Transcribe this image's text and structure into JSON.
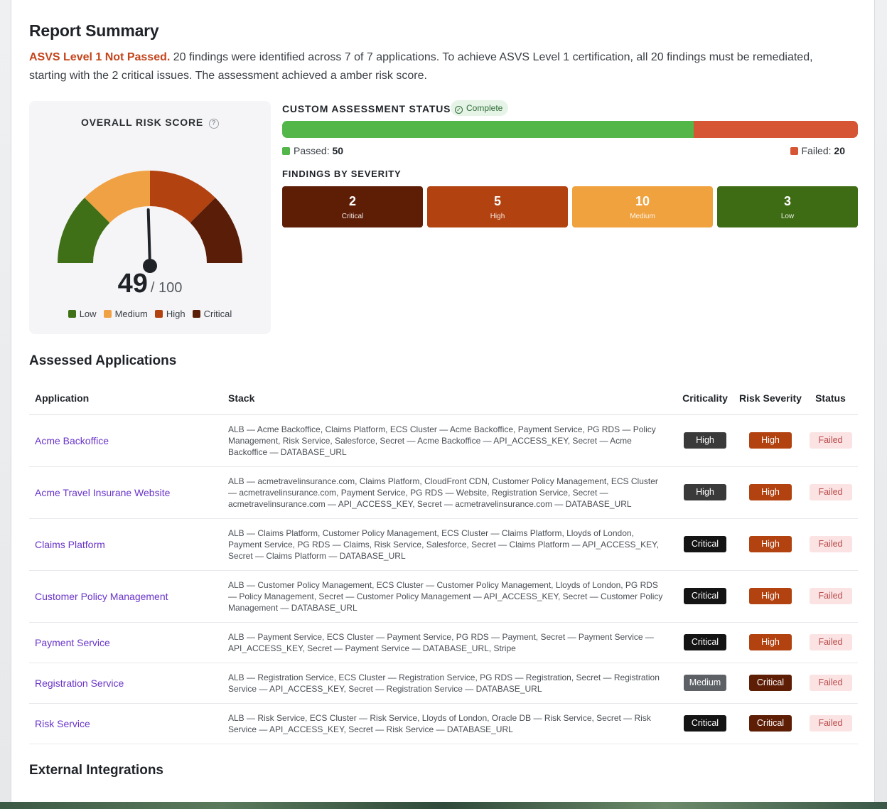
{
  "report": {
    "title": "Report Summary",
    "summary_status": "ASVS Level 1 Not Passed.",
    "summary_text": " 20 findings were identified across 7 of 7 applications. To achieve ASVS Level 1 certification, all 20 findings must be remediated, starting with the 2 critical issues. The assessment achieved a amber risk score."
  },
  "risk_score": {
    "title": "OVERALL RISK SCORE",
    "help_icon": "?",
    "value": "49",
    "max": "/ 100",
    "score_numeric": 49,
    "colors": {
      "low": "#3f6f16",
      "medium": "#f0a144",
      "high": "#b2420f",
      "critical": "#5a1d07"
    },
    "legend": [
      {
        "label": "Low",
        "color": "#3f6f16"
      },
      {
        "label": "Medium",
        "color": "#f0a144"
      },
      {
        "label": "High",
        "color": "#b2420f"
      },
      {
        "label": "Critical",
        "color": "#5a1d07"
      }
    ]
  },
  "custom_assessment": {
    "title": "CUSTOM ASSESSMENT STATUS",
    "badge": "Complete",
    "badge_icon": "check-circle-icon",
    "passed_label": "Passed: ",
    "passed_value": "50",
    "passed": 50,
    "failed_label": "Failed: ",
    "failed_value": "20",
    "failed": 20,
    "pass_color": "#52b649",
    "fail_color": "#d55535"
  },
  "findings_by_severity": {
    "title": "FINDINGS BY SEVERITY",
    "items": [
      {
        "count": "2",
        "label": "Critical",
        "color": "#5e1e06"
      },
      {
        "count": "5",
        "label": "High",
        "color": "#b2420f"
      },
      {
        "count": "10",
        "label": "Medium",
        "color": "#f0a23e"
      },
      {
        "count": "3",
        "label": "Low",
        "color": "#3e6c14"
      }
    ]
  },
  "applications": {
    "title": "Assessed Applications",
    "columns": [
      "Application",
      "Stack",
      "Criticality",
      "Risk Severity",
      "Status"
    ],
    "pill_colors": {
      "High": "#3a3a3a",
      "Critical": "#141414",
      "Medium": "#5d6166",
      "risk_High": "#b2420f",
      "risk_Critical": "#5e1e06"
    },
    "rows": [
      {
        "name": "Acme Backoffice",
        "stack": "ALB — Acme Backoffice, Claims Platform, ECS Cluster — Acme Backoffice, Payment Service, PG RDS — Policy Management, Risk Service, Salesforce, Secret — Acme Backoffice — API_ACCESS_KEY, Secret — Acme Backoffice — DATABASE_URL",
        "criticality": "High",
        "risk": "High",
        "status": "Failed"
      },
      {
        "name": "Acme Travel Insurane Website",
        "stack": "ALB — acmetravelinsurance.com, Claims Platform, CloudFront CDN, Customer Policy Management, ECS Cluster — acmetravelinsurance.com, Payment Service, PG RDS — Website, Registration Service, Secret — acmetravelinsurance.com — API_ACCESS_KEY, Secret — acmetravelinsurance.com — DATABASE_URL",
        "criticality": "High",
        "risk": "High",
        "status": "Failed"
      },
      {
        "name": "Claims Platform",
        "stack": "ALB — Claims Platform, Customer Policy Management, ECS Cluster — Claims Platform, Lloyds of London, Payment Service, PG RDS — Claims, Risk Service, Salesforce, Secret — Claims Platform — API_ACCESS_KEY, Secret — Claims Platform — DATABASE_URL",
        "criticality": "Critical",
        "risk": "High",
        "status": "Failed"
      },
      {
        "name": "Customer Policy Management",
        "stack": "ALB — Customer Policy Management, ECS Cluster — Customer Policy Management, Lloyds of London, PG RDS — Policy Management, Secret — Customer Policy Management — API_ACCESS_KEY, Secret — Customer Policy Management — DATABASE_URL",
        "criticality": "Critical",
        "risk": "High",
        "status": "Failed"
      },
      {
        "name": "Payment Service",
        "stack": "ALB — Payment Service, ECS Cluster — Payment Service, PG RDS — Payment, Secret — Payment Service — API_ACCESS_KEY, Secret — Payment Service — DATABASE_URL, Stripe",
        "criticality": "Critical",
        "risk": "High",
        "status": "Failed"
      },
      {
        "name": "Registration Service",
        "stack": "ALB — Registration Service, ECS Cluster — Registration Service, PG RDS — Registration, Secret — Registration Service — API_ACCESS_KEY, Secret — Registration Service — DATABASE_URL",
        "criticality": "Medium",
        "risk": "Critical",
        "status": "Failed"
      },
      {
        "name": "Risk Service",
        "stack": "ALB — Risk Service, ECS Cluster — Risk Service, Lloyds of London, Oracle DB — Risk Service, Secret — Risk Service — API_ACCESS_KEY, Secret — Risk Service — DATABASE_URL",
        "criticality": "Critical",
        "risk": "Critical",
        "status": "Failed"
      }
    ]
  },
  "external_integrations": {
    "title": "External Integrations"
  }
}
